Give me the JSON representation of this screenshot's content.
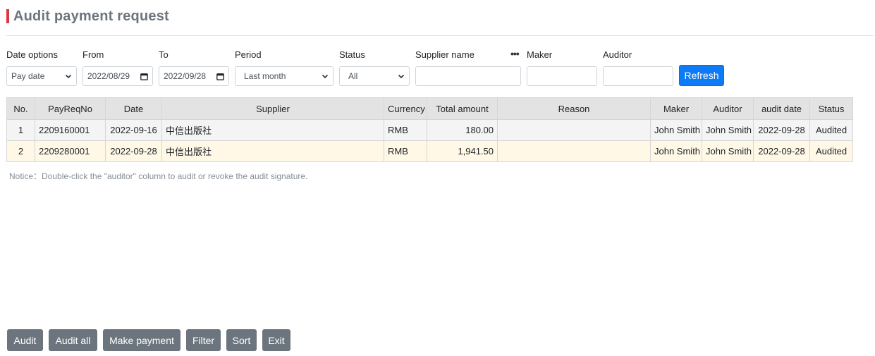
{
  "page": {
    "title": "Audit payment request"
  },
  "filters": {
    "date_options": {
      "label": "Date options",
      "value": "Pay date"
    },
    "from": {
      "label": "From",
      "value": "2022/08/29"
    },
    "to": {
      "label": "To",
      "value": "2022/09/28"
    },
    "period": {
      "label": "Period",
      "value": "Last month"
    },
    "status": {
      "label": "Status",
      "value": "All"
    },
    "supplier": {
      "label": "Supplier name",
      "value": ""
    },
    "maker": {
      "label": "Maker",
      "value": ""
    },
    "auditor": {
      "label": "Auditor",
      "value": ""
    },
    "more_icon": "ellipsis-icon",
    "refresh_label": "Refresh"
  },
  "table": {
    "columns": [
      "No.",
      "PayReqNo",
      "Date",
      "Supplier",
      "Currency",
      "Total amount",
      "Reason",
      "Maker",
      "Auditor",
      "audit date",
      "Status"
    ],
    "rows": [
      [
        "1",
        "2209160001",
        "2022-09-16",
        "中信出版社",
        "RMB",
        "180.00",
        "",
        "John Smith",
        "John Smith",
        "2022-09-28",
        "Audited"
      ],
      [
        "2",
        "2209280001",
        "2022-09-28",
        "中信出版社",
        "RMB",
        "1,941.50",
        "",
        "John Smith",
        "John Smith",
        "2022-09-28",
        "Audited"
      ]
    ]
  },
  "notice": "Notice：Double-click the \"auditor\" column to audit or revoke the audit signature.",
  "actions": {
    "audit": "Audit",
    "audit_all": "Audit all",
    "make_payment": "Make payment",
    "filter": "Filter",
    "sort": "Sort",
    "exit": "Exit"
  },
  "colors": {
    "accent": "#dc3545",
    "primary": "#0d7bf5",
    "secondary": "#6c757d",
    "row_highlight": "#fff8e6"
  }
}
